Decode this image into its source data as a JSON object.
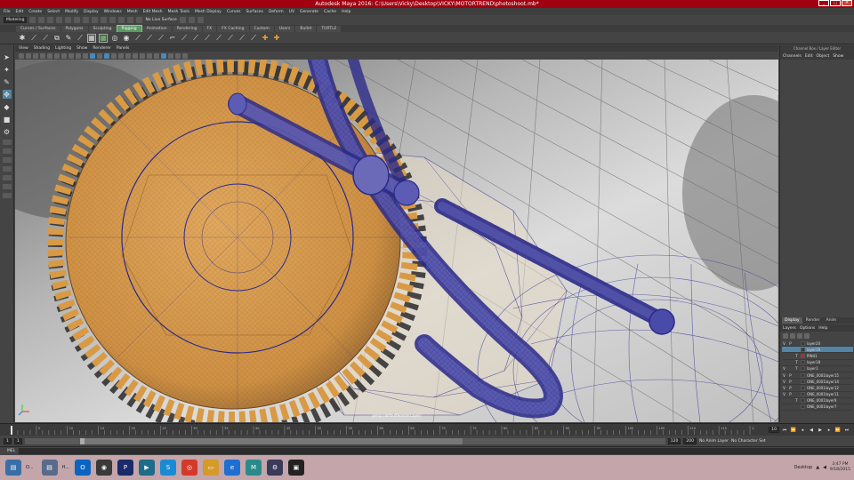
{
  "window": {
    "title": "Autodesk Maya 2016: C:\\Users\\Vicky\\Desktop\\VICKY\\MOTORTREND\\photoshoot.mb*"
  },
  "menubar": [
    "File",
    "Edit",
    "Create",
    "Select",
    "Modify",
    "Display",
    "Windows",
    "Mesh",
    "Edit Mesh",
    "Mesh Tools",
    "Mesh Display",
    "Curves",
    "Surfaces",
    "Deform",
    "UV",
    "Generate",
    "Cache",
    "Help"
  ],
  "statusline": {
    "mode": "Modeling",
    "live_surface": "No Live Surface"
  },
  "shelf_tabs": [
    {
      "label": "Curves / Surfaces",
      "active": false
    },
    {
      "label": "Polygons",
      "active": false
    },
    {
      "label": "Sculpting",
      "active": false
    },
    {
      "label": "Rigging",
      "active": true
    },
    {
      "label": "Animation",
      "active": false
    },
    {
      "label": "Rendering",
      "active": false
    },
    {
      "label": "FX",
      "active": false
    },
    {
      "label": "FX Caching",
      "active": false
    },
    {
      "label": "Custom",
      "active": false
    },
    {
      "label": "Users",
      "active": false
    },
    {
      "label": "Bullet",
      "active": false
    },
    {
      "label": "TURTLE",
      "active": false
    }
  ],
  "viewport": {
    "menu": [
      "View",
      "Shading",
      "Lighting",
      "Show",
      "Renderer",
      "Panels"
    ],
    "camera_label": "persp (defaultRenderLayer)"
  },
  "channel_box": {
    "header": "Channel Box / Layer Editor",
    "menu": [
      "Channels",
      "Edit",
      "Object",
      "Show"
    ]
  },
  "layer_editor": {
    "tabs": [
      {
        "label": "Display",
        "active": true
      },
      {
        "label": "Render",
        "active": false
      },
      {
        "label": "Anim",
        "active": false
      }
    ],
    "menu": [
      "Layers",
      "Options",
      "Help"
    ],
    "layers": [
      {
        "v": "V",
        "p": "P",
        "t": "",
        "color": "none",
        "name": "layer20",
        "selected": false
      },
      {
        "v": "",
        "p": "",
        "t": "",
        "color": "none",
        "name": "layer19",
        "selected": true
      },
      {
        "v": "",
        "p": "",
        "t": "T",
        "color": "red",
        "name": "PIN41",
        "selected": false
      },
      {
        "v": "",
        "p": "",
        "t": "T",
        "color": "none",
        "name": "layer18",
        "selected": false
      },
      {
        "v": "V",
        "p": "",
        "t": "T",
        "color": "none",
        "name": "layer1",
        "selected": false
      },
      {
        "v": "V",
        "p": "P",
        "t": "",
        "color": "none",
        "name": "ONE_0001layer15",
        "selected": false
      },
      {
        "v": "V",
        "p": "P",
        "t": "",
        "color": "none",
        "name": "ONE_0001layer14",
        "selected": false
      },
      {
        "v": "V",
        "p": "P",
        "t": "",
        "color": "none",
        "name": "ONE_0001layer12",
        "selected": false
      },
      {
        "v": "V",
        "p": "P",
        "t": "",
        "color": "none",
        "name": "ONE_0001layer11",
        "selected": false
      },
      {
        "v": "",
        "p": "",
        "t": "T",
        "color": "none",
        "name": "ONE_0001layer9",
        "selected": false
      },
      {
        "v": "",
        "p": "",
        "t": "",
        "color": "none",
        "name": "ONE_0001layer7",
        "selected": false
      }
    ]
  },
  "timeline": {
    "start": "1",
    "current": "1",
    "end_field": "10",
    "tick_labels": [
      "5",
      "10",
      "15",
      "20",
      "25",
      "30",
      "35",
      "40",
      "45",
      "50",
      "55",
      "60",
      "65",
      "70",
      "75",
      "80",
      "85",
      "90",
      "95",
      "100",
      "105",
      "110",
      "115",
      "120"
    ]
  },
  "range": {
    "start_a": "1",
    "start_b": "1",
    "range_start": "1",
    "range_end": "120",
    "end_a": "120",
    "end_b": "200",
    "anim_layer": "No Anim Layer",
    "char_set": "No Character Set"
  },
  "command_line": {
    "label": "MEL"
  },
  "taskbar": {
    "items": [
      {
        "label": "O...",
        "icon": "window-icon"
      },
      {
        "label": "H...",
        "icon": "window-icon"
      }
    ],
    "desktop_label": "Desktop",
    "time": "3:47 PM",
    "date": "9/18/2015"
  },
  "colors": {
    "title_bar": "#a00010",
    "active_shelf_tab": "#5a9a64",
    "gear": "#d99a45",
    "wire": "#2a2a8a",
    "selected_layer": "#5285a6"
  }
}
